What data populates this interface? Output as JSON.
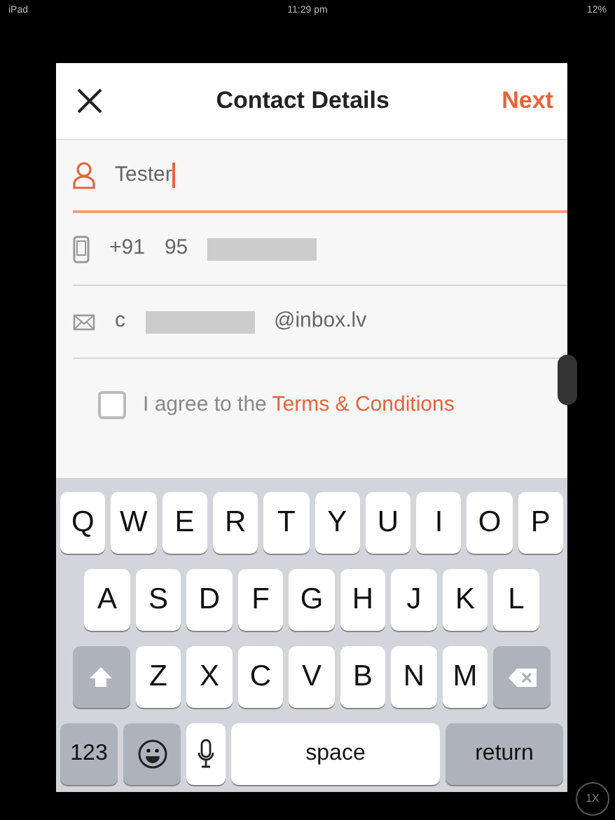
{
  "status_bar": {
    "carrier": "iPad",
    "time": "11:29 pm",
    "battery": "12%"
  },
  "header": {
    "title": "Contact Details",
    "next": "Next"
  },
  "fields": [
    {
      "kind": "name",
      "value": "Tester",
      "focused": true,
      "redacted": false
    },
    {
      "kind": "phone",
      "code": "+91",
      "value": "95",
      "redacted": true,
      "focused": false
    },
    {
      "kind": "email",
      "value": "c",
      "suffix": "@inbox.lv",
      "redacted": true,
      "focused": false
    }
  ],
  "agreement": {
    "checked": false,
    "text": "I agree to the",
    "link": "Terms & Conditions"
  },
  "keyboard": [
    [
      {
        "kind": "letter",
        "label": "Q"
      },
      {
        "kind": "letter",
        "label": "W"
      },
      {
        "kind": "letter",
        "label": "E"
      },
      {
        "kind": "letter",
        "label": "R"
      },
      {
        "kind": "letter",
        "label": "T"
      },
      {
        "kind": "letter",
        "label": "Y"
      },
      {
        "kind": "letter",
        "label": "U"
      },
      {
        "kind": "letter",
        "label": "I"
      },
      {
        "kind": "letter",
        "label": "O"
      },
      {
        "kind": "letter",
        "label": "P"
      }
    ],
    [
      {
        "kind": "letter",
        "label": "A"
      },
      {
        "kind": "letter",
        "label": "S"
      },
      {
        "kind": "letter",
        "label": "D"
      },
      {
        "kind": "letter",
        "label": "F"
      },
      {
        "kind": "letter",
        "label": "G"
      },
      {
        "kind": "letter",
        "label": "H"
      },
      {
        "kind": "letter",
        "label": "J"
      },
      {
        "kind": "letter",
        "label": "K"
      },
      {
        "kind": "letter",
        "label": "L"
      }
    ],
    [
      {
        "kind": "shift"
      },
      {
        "kind": "letter",
        "label": "Z"
      },
      {
        "kind": "letter",
        "label": "X"
      },
      {
        "kind": "letter",
        "label": "C"
      },
      {
        "kind": "letter",
        "label": "V"
      },
      {
        "kind": "letter",
        "label": "B"
      },
      {
        "kind": "letter",
        "label": "N"
      },
      {
        "kind": "letter",
        "label": "M"
      },
      {
        "kind": "backspace"
      }
    ],
    [
      {
        "kind": "mode",
        "label": "123"
      },
      {
        "kind": "emoji"
      },
      {
        "kind": "mic"
      },
      {
        "kind": "space",
        "label": "space"
      },
      {
        "kind": "return",
        "label": "return"
      }
    ]
  ],
  "zoom_badge": "1X"
}
